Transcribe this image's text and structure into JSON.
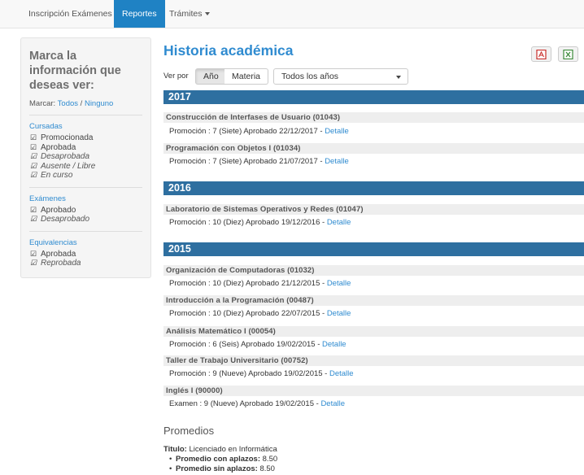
{
  "nav": {
    "tabs": [
      "Inscripción Exámenes",
      "Reportes",
      "Trámites"
    ],
    "active_tab": "Reportes"
  },
  "sidebar": {
    "title": "Marca la información que deseas ver:",
    "marcar_label": "Marcar:",
    "todos": "Todos",
    "sep": "/",
    "ninguno": "Ninguno",
    "groups": [
      {
        "title": "Cursadas",
        "options": [
          {
            "label": "Promocionada",
            "checked": true,
            "italic": false
          },
          {
            "label": "Aprobada",
            "checked": true,
            "italic": false
          },
          {
            "label": "Desaprobada",
            "checked": true,
            "italic": true
          },
          {
            "label": "Ausente / Libre",
            "checked": true,
            "italic": true
          },
          {
            "label": "En curso",
            "checked": true,
            "italic": true
          }
        ]
      },
      {
        "title": "Exámenes",
        "options": [
          {
            "label": "Aprobado",
            "checked": true,
            "italic": false
          },
          {
            "label": "Desaprobado",
            "checked": true,
            "italic": true
          }
        ]
      },
      {
        "title": "Equivalencias",
        "options": [
          {
            "label": "Aprobada",
            "checked": true,
            "italic": false
          },
          {
            "label": "Reprobada",
            "checked": true,
            "italic": true
          }
        ]
      }
    ]
  },
  "main": {
    "title": "Historia académica",
    "export_pdf_icon": "pdf-icon",
    "export_excel_icon": "excel-icon",
    "ver_por_label": "Ver por",
    "view_buttons": [
      "Año",
      "Materia"
    ],
    "active_view": "Año",
    "year_filter": "Todos los años",
    "detail_link": "Detalle",
    "years": [
      {
        "year": "2017",
        "subjects": [
          {
            "name": "Construcción de Interfases de Usuario (01043)",
            "detail": "Promoción : 7 (Siete) Aprobado 22/12/2017 - "
          },
          {
            "name": "Programación con Objetos I (01034)",
            "detail": "Promoción : 7 (Siete) Aprobado 21/07/2017 - "
          }
        ]
      },
      {
        "year": "2016",
        "subjects": [
          {
            "name": "Laboratorio de Sistemas Operativos y Redes (01047)",
            "detail": "Promoción : 10 (Diez) Aprobado 19/12/2016 - "
          }
        ]
      },
      {
        "year": "2015",
        "subjects": [
          {
            "name": "Organización de Computadoras (01032)",
            "detail": "Promoción : 10 (Diez) Aprobado 21/12/2015 - "
          },
          {
            "name": "Introducción a la Programación (00487)",
            "detail": "Promoción : 10 (Diez) Aprobado 22/07/2015 - "
          },
          {
            "name": "Análisis Matemático I (00054)",
            "detail": "Promoción : 6 (Seis) Aprobado 19/02/2015 - "
          },
          {
            "name": "Taller de Trabajo Universitario (00752)",
            "detail": "Promoción : 9 (Nueve) Aprobado 19/02/2015 - "
          },
          {
            "name": "Inglés I (90000)",
            "detail": "Examen : 9 (Nueve) Aprobado 19/02/2015 - "
          }
        ]
      }
    ]
  },
  "promedios": {
    "title": "Promedios",
    "titulo_label": "Titulo:",
    "titulo_value": "Licenciado en Informática",
    "con_aplazos_label": "Promedio con aplazos:",
    "con_aplazos_value": "8.50",
    "sin_aplazos_label": "Promedio sin aplazos:",
    "sin_aplazos_value": "8.50"
  }
}
